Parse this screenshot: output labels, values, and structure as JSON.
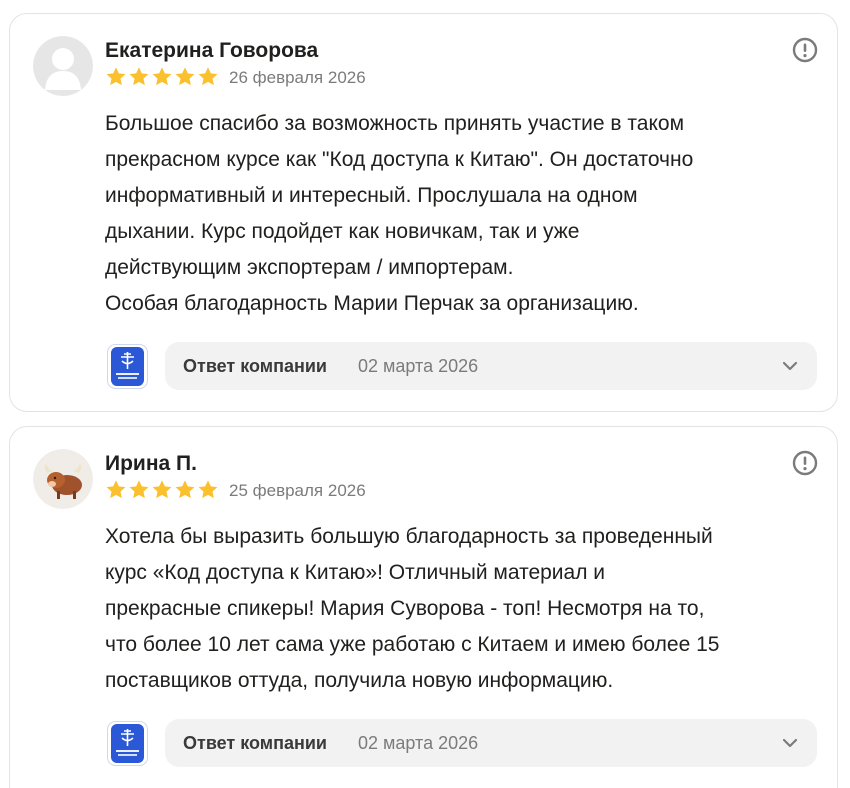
{
  "reviews": [
    {
      "author": "Екатерина Говорова",
      "rating": 5,
      "date": "26 февраля 2026",
      "avatar_icon": "default-user-avatar",
      "text_lines": [
        "Большое спасибо за возможность принять участие в таком",
        "прекрасном курсе как \"Код доступа к Китаю\". Он достаточно",
        "информативный и интересный. Прослушала на одном",
        "дыхании. Курс подойдет как новичкам, так и уже",
        "действующим экспортерам / импортерам.",
        "Особая благодарность Марии Перчак за организацию."
      ],
      "reply": {
        "label": "Ответ компании",
        "date": "02 марта 2026"
      }
    },
    {
      "author": "Ирина П.",
      "rating": 5,
      "date": "25 февраля 2026",
      "avatar_icon": "yak-avatar",
      "text_lines": [
        "Хотела бы выразить большую благодарность за проведенный",
        "курс «Код доступа к Китаю»! Отличный материал и",
        "прекрасные спикеры! Мария Суворова - топ! Несмотря на то,",
        "что более 10 лет сама уже работаю с Китаем и имею более 15",
        "поставщиков оттуда, получила новую информацию."
      ],
      "reply": {
        "label": "Ответ компании",
        "date": "02 марта 2026"
      }
    }
  ],
  "colors": {
    "star": "#fbc02d",
    "company_logo": "#2a58d6",
    "muted_text": "#7b7b7b",
    "reply_bg": "#f2f2f2"
  }
}
